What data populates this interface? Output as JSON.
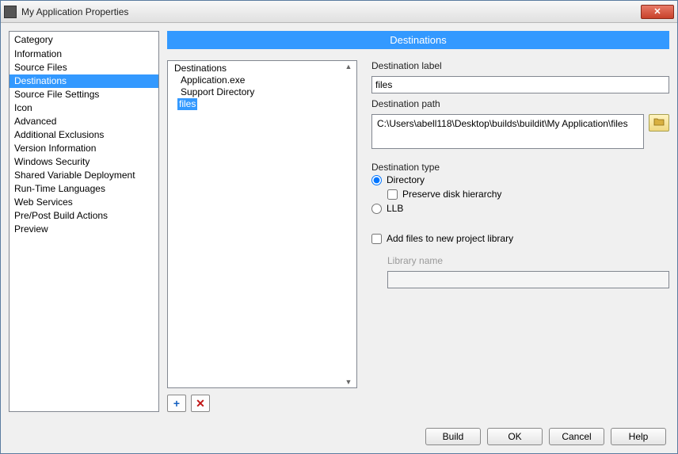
{
  "window": {
    "title": "My Application Properties"
  },
  "sidebar": {
    "header": "Category",
    "items": [
      "Information",
      "Source Files",
      "Destinations",
      "Source File Settings",
      "Icon",
      "Advanced",
      "Additional Exclusions",
      "Version Information",
      "Windows Security",
      "Shared Variable Deployment",
      "Run-Time Languages",
      "Web Services",
      "Pre/Post Build Actions",
      "Preview"
    ],
    "selected_index": 2
  },
  "page": {
    "header": "Destinations",
    "dest_list": {
      "items": [
        "Destinations",
        "Application.exe",
        "Support Directory",
        "files"
      ],
      "selected_index": 3
    },
    "buttons": {
      "add": "+",
      "delete": "✕"
    },
    "dest_label": {
      "label": "Destination label",
      "value": "files"
    },
    "dest_path": {
      "label": "Destination path",
      "value": "C:\\Users\\abell118\\Desktop\\builds\\buildit\\My Application\\files"
    },
    "dest_type": {
      "label": "Destination type",
      "directory": "Directory",
      "preserve": "Preserve disk hierarchy",
      "llb": "LLB",
      "selected": "directory",
      "preserve_checked": false
    },
    "add_files": {
      "label": "Add files to new project library",
      "checked": false,
      "lib_label": "Library name",
      "lib_value": ""
    }
  },
  "footer": {
    "build": "Build",
    "ok": "OK",
    "cancel": "Cancel",
    "help": "Help"
  }
}
